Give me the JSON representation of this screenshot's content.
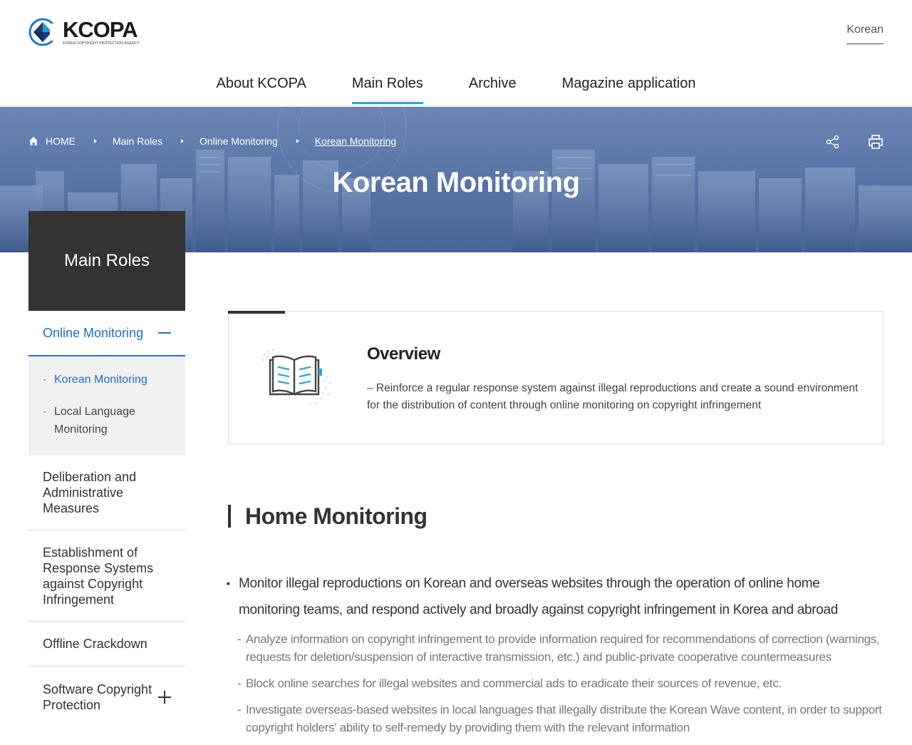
{
  "header": {
    "logo_name": "KCOPA",
    "logo_sub": "KOREA COPYRIGHT PROTECTION AGENCY",
    "language": "Korean",
    "nav": [
      {
        "label": "About KCOPA"
      },
      {
        "label": "Main Roles"
      },
      {
        "label": "Archive"
      },
      {
        "label": "Magazine application"
      }
    ]
  },
  "banner": {
    "breadcrumb": {
      "home": "HOME",
      "items": [
        "Main Roles",
        "Online Monitoring",
        "Korean Monitoring"
      ]
    },
    "title": "Korean Monitoring"
  },
  "sidebar": {
    "title": "Main Roles",
    "active_item": "Online Monitoring",
    "sub_items": [
      "Korean Monitoring",
      "Local Language Monitoring"
    ],
    "items": [
      "Deliberation and Administrative Measures",
      "Establishment of Response Systems against Copyright Infringement",
      "Offline Crackdown",
      "Software Copyright Protection"
    ]
  },
  "overview": {
    "title": "Overview",
    "text": "– Reinforce a regular response system against illegal reproductions and create a sound environment for the distribution of content through online monitoring on copyright infringement"
  },
  "section": {
    "title": "Home Monitoring",
    "main_bullet": "Monitor illegal reproductions on Korean and overseas websites through the operation of online home monitoring teams, and respond actively and broadly against copyright infringement in Korea and abroad",
    "sub_bullets": [
      "Analyze information on copyright infringement to provide information required for recommendations of correction (warnings, requests for deletion/suspension of interactive transmission, etc.) and public-private cooperative countermeasures",
      "Block online searches for illegal websites and commercial ads to eradicate their sources of revenue, etc.",
      "Investigate overseas-based websites in local languages that illegally distribute the Korean Wave content, in order to support copyright holders' ability to self-remedy by providing them with the relevant information"
    ]
  },
  "colors": {
    "accent_blue": "#1a6fd0",
    "nav_underline": "#2aa6d9",
    "sidebar_head": "#333333"
  }
}
